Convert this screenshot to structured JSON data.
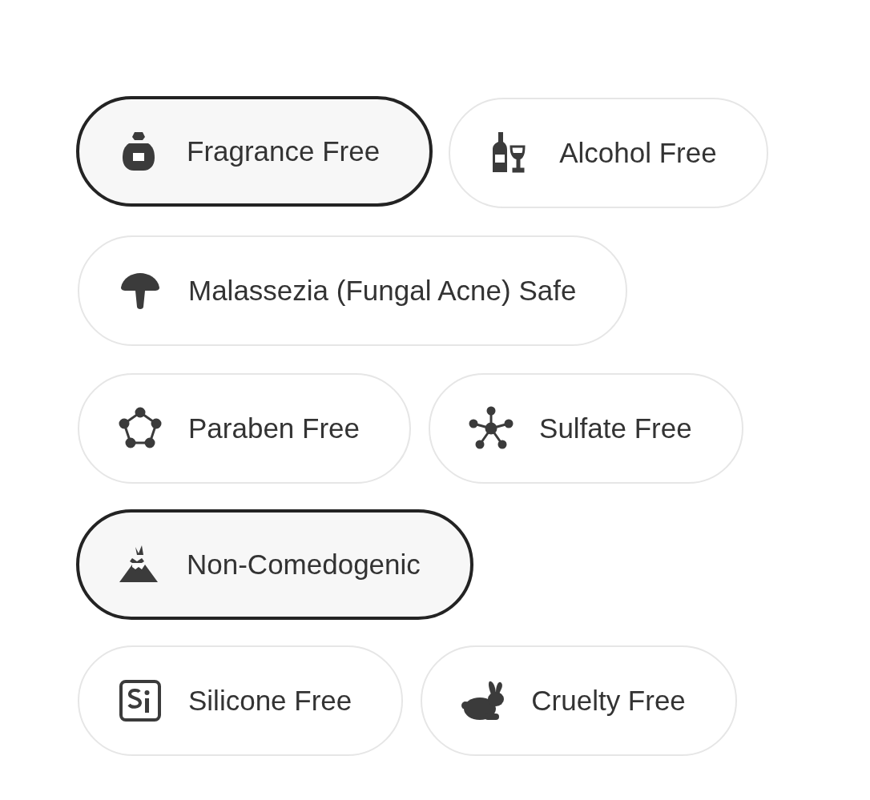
{
  "rows": [
    {
      "chips": [
        {
          "label": "Fragrance Free",
          "selected": true
        },
        {
          "label": "Alcohol Free",
          "selected": false
        }
      ]
    },
    {
      "chips": [
        {
          "label": "Malassezia (Fungal Acne) Safe",
          "selected": false
        }
      ]
    },
    {
      "chips": [
        {
          "label": "Paraben Free",
          "selected": false
        },
        {
          "label": "Sulfate Free",
          "selected": false
        }
      ]
    },
    {
      "chips": [
        {
          "label": "Non-Comedogenic",
          "selected": true
        }
      ]
    },
    {
      "chips": [
        {
          "label": "Silicone Free",
          "selected": false
        },
        {
          "label": "Cruelty Free",
          "selected": false
        }
      ]
    }
  ]
}
